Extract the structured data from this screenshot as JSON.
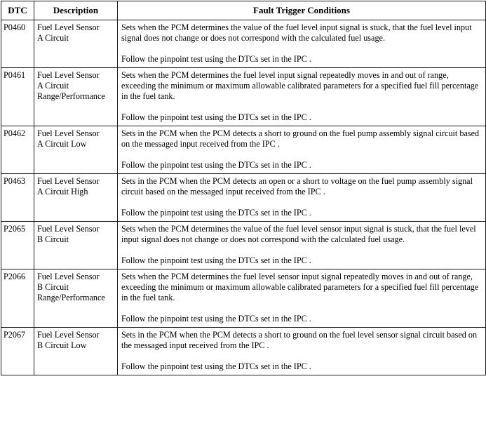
{
  "table": {
    "columns": [
      {
        "key": "dtc",
        "label": "DTC"
      },
      {
        "key": "description",
        "label": "Description"
      },
      {
        "key": "fault",
        "label": "Fault Trigger Conditions"
      }
    ],
    "rows": [
      {
        "dtc": "P0460",
        "description_lines": [
          "Fuel Level Sensor",
          "A Circuit"
        ],
        "fault_paragraphs": [
          "Sets when the PCM determines the value of the fuel level input signal is stuck, that the fuel level input signal does not change or does not correspond with the calculated fuel usage.",
          "Follow the pinpoint test using the DTCs set in the IPC ."
        ]
      },
      {
        "dtc": "P0461",
        "description_lines": [
          "Fuel Level Sensor",
          "A Circuit",
          "Range/Performance"
        ],
        "fault_paragraphs": [
          "Sets when the PCM determines the fuel level input signal repeatedly moves in and out of range, exceeding the minimum or maximum allowable calibrated parameters for a specified fuel fill percentage in the fuel tank.",
          "Follow the pinpoint test using the DTCs set in the IPC ."
        ]
      },
      {
        "dtc": "P0462",
        "description_lines": [
          "Fuel Level Sensor",
          "A Circuit Low"
        ],
        "fault_paragraphs": [
          "Sets in the PCM when the PCM detects a short to ground on the fuel pump assembly signal circuit based on the messaged input received from the IPC .",
          "Follow the pinpoint test using the DTCs set in the IPC ."
        ]
      },
      {
        "dtc": "P0463",
        "description_lines": [
          "Fuel Level Sensor",
          "A Circuit High"
        ],
        "fault_paragraphs": [
          "Sets in the PCM when the PCM detects an open or a short to voltage on the fuel pump assembly signal circuit based on the messaged input received from the IPC .",
          "Follow the pinpoint test using the DTCs set in the IPC ."
        ]
      },
      {
        "dtc": "P2065",
        "description_lines": [
          "Fuel Level Sensor",
          "B Circuit"
        ],
        "fault_paragraphs": [
          "Sets when the PCM determines the value of the fuel level sensor input signal is stuck, that the fuel level input signal does not change or does not correspond with the calculated fuel usage.",
          "Follow the pinpoint test using the DTCs set in the IPC ."
        ]
      },
      {
        "dtc": "P2066",
        "description_lines": [
          "Fuel Level Sensor",
          "B Circuit",
          "Range/Performance"
        ],
        "fault_paragraphs": [
          "Sets when the PCM determines the fuel level sensor input signal repeatedly moves in and out of range, exceeding the minimum or maximum allowable calibrated parameters for a specified fuel fill percentage in the fuel tank.",
          "Follow the pinpoint test using the DTCs set in the IPC ."
        ]
      },
      {
        "dtc": "P2067",
        "description_lines": [
          "Fuel Level Sensor",
          "B Circuit Low"
        ],
        "fault_paragraphs": [
          "Sets in the PCM when the PCM detects a short to ground on the fuel level sensor signal circuit based on the messaged input received from the IPC .",
          "Follow the pinpoint test using the DTCs set in the IPC ."
        ]
      }
    ]
  }
}
